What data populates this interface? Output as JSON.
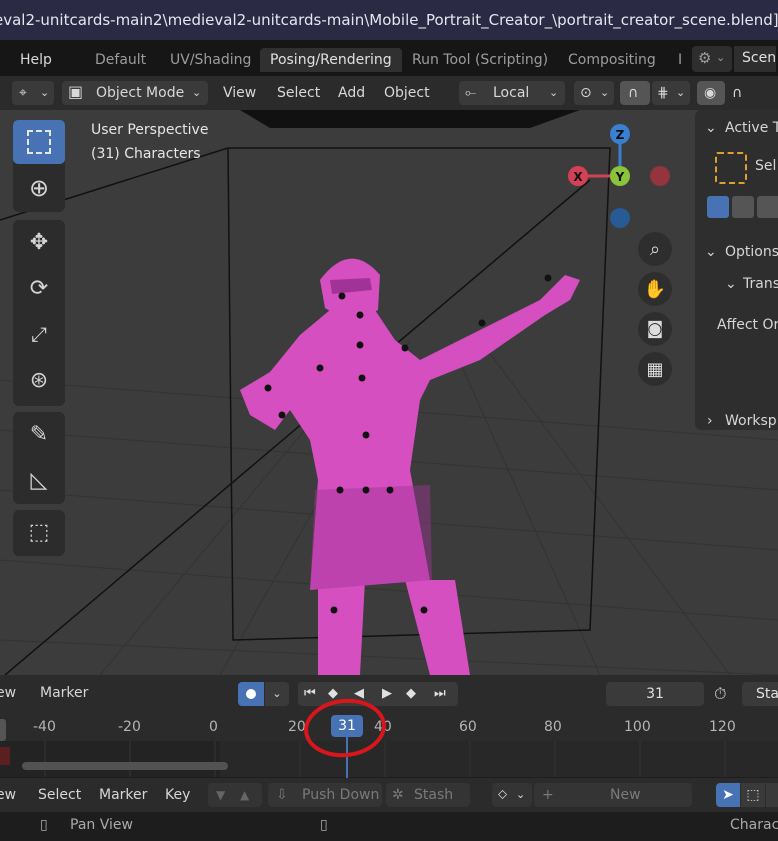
{
  "title_bar": {
    "path": "eval2-unitcards-main2\\medieval2-unitcards-main\\Mobile_Portrait_Creator_\\portrait_creator_scene.blend]"
  },
  "workspace_tabs": {
    "help": "Help",
    "tabs": [
      "Default",
      "UV/Shading",
      "Posing/Rendering",
      "Run Tool (Scripting)",
      "Compositing",
      "I"
    ],
    "active": "Posing/Rendering",
    "scene": "Scen"
  },
  "header": {
    "mode": "Object Mode",
    "menu": [
      "View",
      "Select",
      "Add",
      "Object"
    ],
    "transform_orientation": "Local"
  },
  "viewport": {
    "overlay_line1": "User Perspective",
    "overlay_line2": "(31) Characters",
    "mesh_color": "#d64fc0",
    "gizmo": {
      "x": "X",
      "y": "Y",
      "z": "Z"
    }
  },
  "n_panel": {
    "active_tool": "Active T",
    "select": "Sel",
    "options": "Options",
    "transform": "Trans",
    "affect_only": "Affect Or",
    "workspace": "Worksp"
  },
  "timeline": {
    "menu": [
      "ew",
      "Marker"
    ],
    "current_frame": "31",
    "start_label": "Sta",
    "ruler": [
      "-40",
      "-20",
      "0",
      "20",
      "31",
      "40",
      "60",
      "80",
      "100",
      "120"
    ]
  },
  "nla": {
    "menu": [
      "ew",
      "Select",
      "Marker",
      "Key"
    ],
    "push_down": "Push Down",
    "stash": "Stash",
    "new": "New"
  },
  "status_bar": {
    "pan_view": "Pan View",
    "right": "Charac"
  }
}
